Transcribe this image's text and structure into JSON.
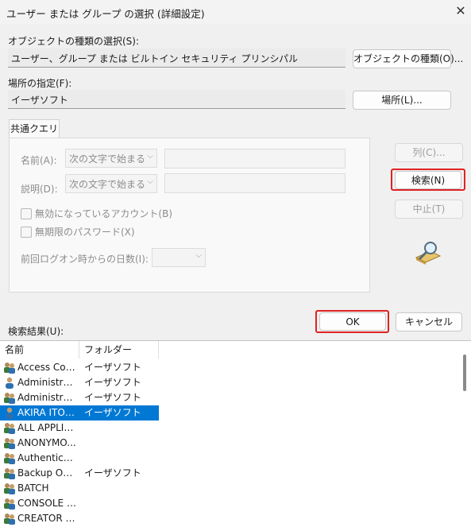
{
  "window": {
    "title": "ユーザー または グループ の選択 (詳細設定)",
    "close_glyph": "✕"
  },
  "object_type": {
    "label": "オブジェクトの種類の選択(S):",
    "value": "ユーザー、グループ または ビルトイン セキュリティ プリンシパル",
    "button": "オブジェクトの種類(O)..."
  },
  "location": {
    "label": "場所の指定(F):",
    "value": "イーザソフト",
    "button": "場所(L)..."
  },
  "tab": {
    "label": "共通クエリ"
  },
  "query": {
    "name_label": "名前(A):",
    "name_combo": "次の文字で始まる",
    "desc_label": "説明(D):",
    "desc_combo": "次の文字で始まる",
    "disabled_accounts": "無効になっているアカウント(B)",
    "non_expiring_pw": "無期限のパスワード(X)",
    "days_label": "前回ログオン時からの日数(I):"
  },
  "buttons": {
    "columns": "列(C)...",
    "search": "検索(N)",
    "stop": "中止(T)",
    "ok": "OK",
    "cancel": "キャンセル"
  },
  "results": {
    "label": "検索結果(U):",
    "columns": [
      "名前",
      "フォルダー"
    ],
    "rows": [
      {
        "name": "Access Cont...",
        "folder": "イーザソフト",
        "icon": "group-icon",
        "selected": false
      },
      {
        "name": "Administrator",
        "folder": "イーザソフト",
        "icon": "user-icon",
        "selected": false
      },
      {
        "name": "Administrat...",
        "folder": "イーザソフト",
        "icon": "group-icon",
        "selected": false
      },
      {
        "name": "AKIRA ITOU ...",
        "folder": "イーザソフト",
        "icon": "user-icon",
        "selected": true
      },
      {
        "name": "ALL APPLIC...",
        "folder": "",
        "icon": "group-icon",
        "selected": false
      },
      {
        "name": "ANONYMO...",
        "folder": "",
        "icon": "group-icon",
        "selected": false
      },
      {
        "name": "Authenticat...",
        "folder": "",
        "icon": "group-icon",
        "selected": false
      },
      {
        "name": "Backup Ope...",
        "folder": "イーザソフト",
        "icon": "group-icon",
        "selected": false
      },
      {
        "name": "BATCH",
        "folder": "",
        "icon": "group-icon",
        "selected": false
      },
      {
        "name": "CONSOLE L...",
        "folder": "",
        "icon": "group-icon",
        "selected": false
      },
      {
        "name": "CREATOR G...",
        "folder": "",
        "icon": "group-icon",
        "selected": false
      }
    ]
  },
  "colors": {
    "selection": "#0078d4",
    "highlight": "#e02323"
  }
}
